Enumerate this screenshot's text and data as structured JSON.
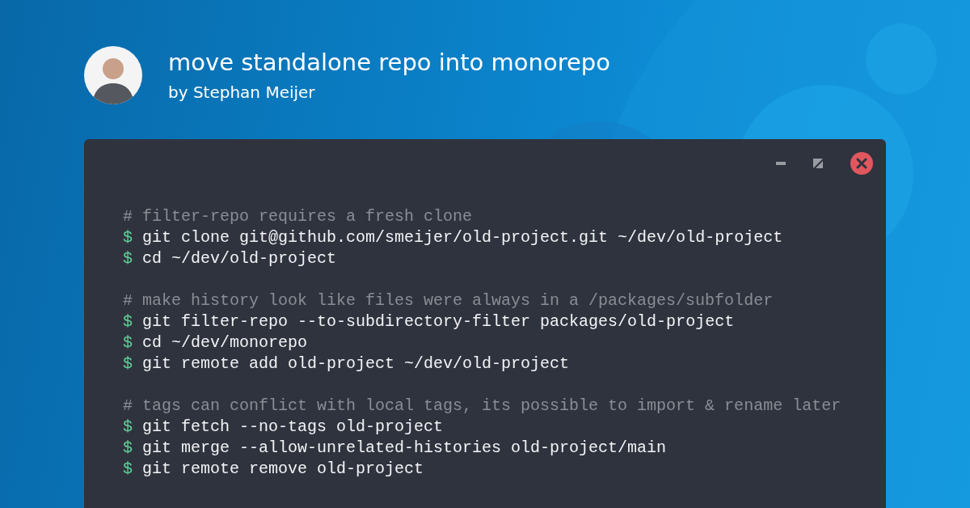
{
  "header": {
    "title": "move standalone repo into monorepo",
    "byline": "by Stephan Meijer"
  },
  "terminal": {
    "controls": [
      {
        "kind": "minimize"
      },
      {
        "kind": "maximize"
      },
      {
        "kind": "close"
      }
    ],
    "lines": [
      {
        "kind": "comment",
        "text": "# filter-repo requires a fresh clone"
      },
      {
        "kind": "command",
        "prompt": "$",
        "text": "git clone git@github.com/smeijer/old-project.git ~/dev/old-project"
      },
      {
        "kind": "command",
        "prompt": "$",
        "text": "cd ~/dev/old-project"
      },
      {
        "kind": "blank"
      },
      {
        "kind": "comment",
        "text": "# make history look like files were always in a /packages/subfolder"
      },
      {
        "kind": "command",
        "prompt": "$",
        "text": "git filter-repo --to-subdirectory-filter packages/old-project"
      },
      {
        "kind": "command",
        "prompt": "$",
        "text": "cd ~/dev/monorepo"
      },
      {
        "kind": "command",
        "prompt": "$",
        "text": "git remote add old-project ~/dev/old-project"
      },
      {
        "kind": "blank"
      },
      {
        "kind": "comment",
        "text": "# tags can conflict with local tags, its possible to import & rename later"
      },
      {
        "kind": "command",
        "prompt": "$",
        "text": "git fetch --no-tags old-project"
      },
      {
        "kind": "command",
        "prompt": "$",
        "text": "git merge --allow-unrelated-histories old-project/main"
      },
      {
        "kind": "command",
        "prompt": "$",
        "text": "git remote remove old-project"
      }
    ]
  }
}
